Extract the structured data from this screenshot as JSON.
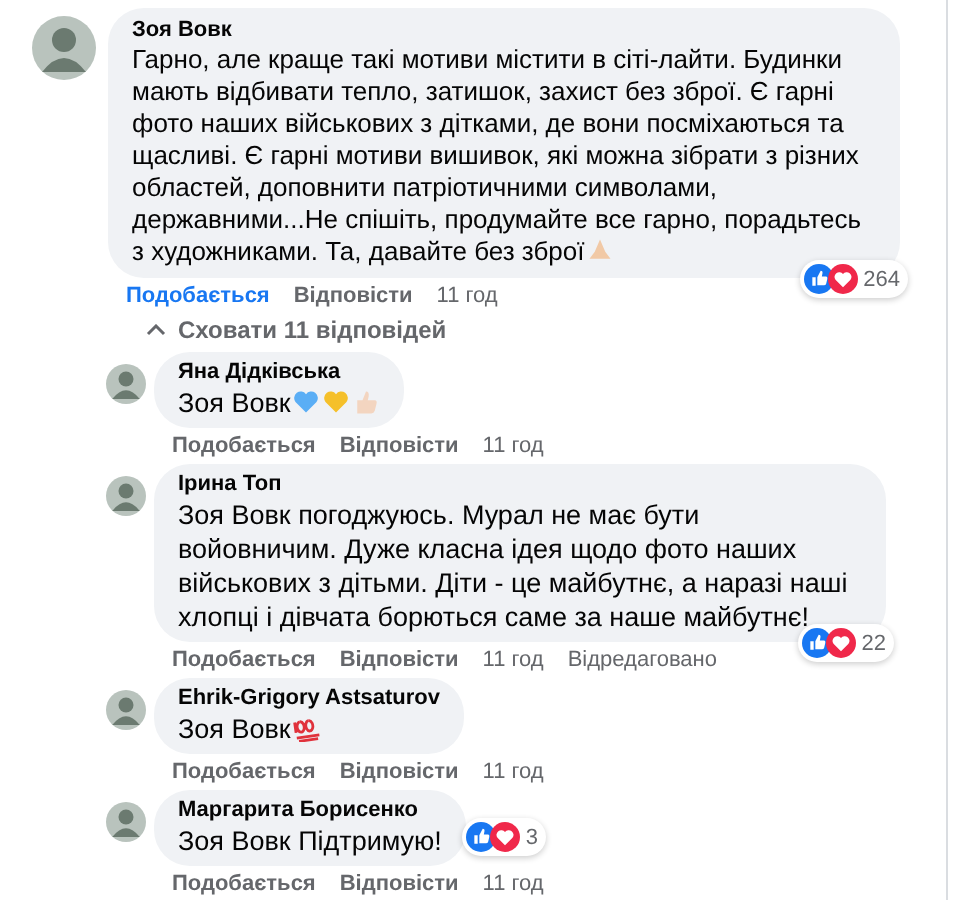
{
  "comment": {
    "author": "Зоя Вовк",
    "text": "Гарно, але краще такі мотиви містити в сіті-лайти. Будинки мають відбивати тепло, затишок, захист без зброї. Є гарні фото наших військових з дітками, де вони посміхаються та щасливі. Є гарні мотиви вишивок, які можна зібрати з різних областей, доповнити патріотичними символами, державними...Не спішіть, продумайте все гарно, порадьтесь з художниками. Та, давайте без зброї",
    "icons": [
      {
        "kind": "pray"
      }
    ],
    "like": "Подобається",
    "liked": true,
    "reply": "Відповісти",
    "time": "11 год",
    "reactions": "264"
  },
  "toggle_replies": "Сховати 11 відповідей",
  "replies": [
    {
      "author": "Яна Дідківська",
      "text": "Зоя Вовк",
      "icons": [
        {
          "kind": "heart",
          "color": "#5aaef5"
        },
        {
          "kind": "heart",
          "color": "#f5c02a"
        },
        {
          "kind": "thumb"
        }
      ],
      "like": "Подобається",
      "liked": false,
      "reply": "Відповісти",
      "time": "11 год"
    },
    {
      "author": "Ірина Топ",
      "text": "Зоя Вовк погоджуюсь. Мурал не має бути войовничим. Дуже класна ідея щодо фото наших військових з дітьми. Діти - це майбутнє, а наразі наші хлопці і дівчата борються саме за наше майбутнє!",
      "like": "Подобається",
      "liked": false,
      "reply": "Відповісти",
      "time": "11 год",
      "edited": "Відредаговано",
      "reactions": "22"
    },
    {
      "author": "Ehrik-Grigory Astsaturov",
      "text": "Зоя Вовк",
      "icons": [
        {
          "kind": "hundred"
        }
      ],
      "like": "Подобається",
      "liked": false,
      "reply": "Відповісти",
      "time": "11 год"
    },
    {
      "author": "Маргарита Борисенко",
      "text": "Зоя Вовк Підтримую!",
      "like": "Подобається",
      "liked": false,
      "reply": "Відповісти",
      "time": "11 год",
      "reactions": "3",
      "reactions_inline": true
    }
  ]
}
